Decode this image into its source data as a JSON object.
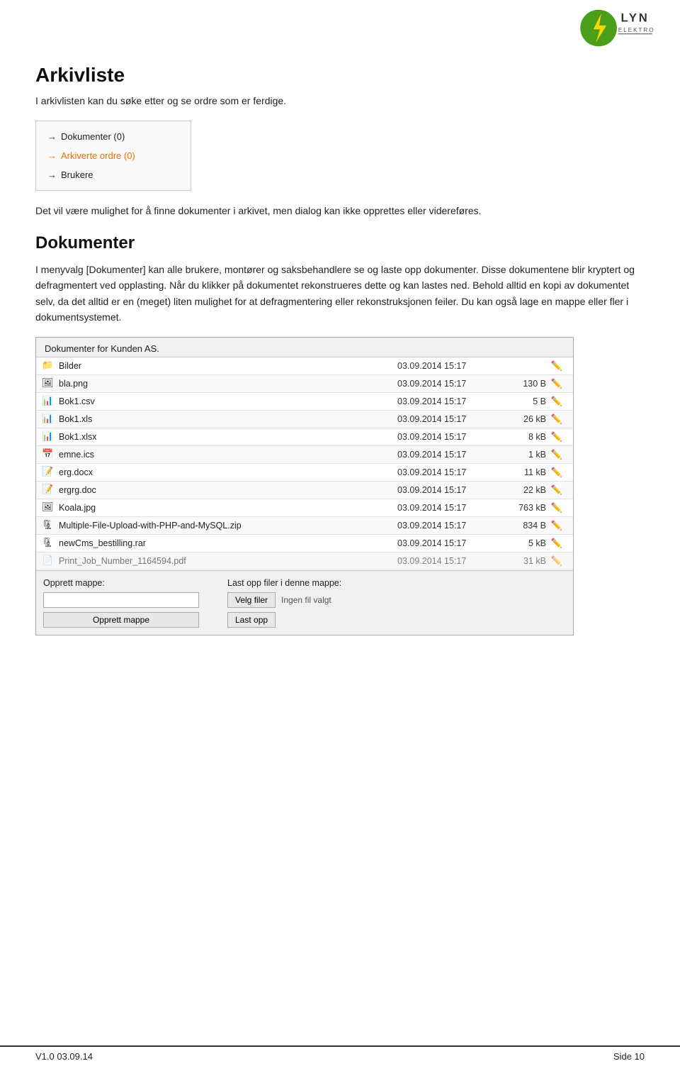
{
  "logo": {
    "alt": "Lyn Elektro logo"
  },
  "page": {
    "title": "Arkivliste",
    "intro": "I arkivlisten kan du søke etter og se ordre som er ferdige.",
    "menu_items": [
      {
        "label": "Dokumenter (0)",
        "style": "normal"
      },
      {
        "label": "Arkiverte ordre (0)",
        "style": "orange"
      },
      {
        "label": "Brukere",
        "style": "normal"
      }
    ],
    "caption": "Det vil være mulighet for å finne dokumenter i arkivet, men dialog kan ikke opprettes eller videreføres.",
    "section_title": "Dokumenter",
    "body1": "I menyvalg [Dokumenter] kan alle brukere, montører og saksbehandlere se og laste opp dokumenter. Disse dokumentene blir kryptert og defragmentert ved opplasting. Når du klikker på dokumentet rekonstrueres dette og kan lastes ned. Behold alltid en kopi av dokumentet selv, da det alltid er en (meget) liten mulighet for at defragmentering eller rekonstruksjonen feiler. Du kan også lage en mappe eller fler i dokumentsystemet.",
    "docs_panel": {
      "title": "Dokumenter for Kunden AS.",
      "rows": [
        {
          "icon": "📁",
          "name": "Bilder",
          "date": "03.09.2014 15:17",
          "size": "",
          "folder": true
        },
        {
          "icon": "🖼",
          "name": "bla.png",
          "date": "03.09.2014 15:17",
          "size": "130 B"
        },
        {
          "icon": "📊",
          "name": "Bok1.csv",
          "date": "03.09.2014 15:17",
          "size": "5 B"
        },
        {
          "icon": "📊",
          "name": "Bok1.xls",
          "date": "03.09.2014 15:17",
          "size": "26 kB"
        },
        {
          "icon": "📊",
          "name": "Bok1.xlsx",
          "date": "03.09.2014 15:17",
          "size": "8 kB"
        },
        {
          "icon": "📅",
          "name": "emne.ics",
          "date": "03.09.2014 15:17",
          "size": "1 kB"
        },
        {
          "icon": "📝",
          "name": "erg.docx",
          "date": "03.09.2014 15:17",
          "size": "11 kB"
        },
        {
          "icon": "📝",
          "name": "ergrg.doc",
          "date": "03.09.2014 15:17",
          "size": "22 kB"
        },
        {
          "icon": "🖼",
          "name": "Koala.jpg",
          "date": "03.09.2014 15:17",
          "size": "763 kB"
        },
        {
          "icon": "🗜",
          "name": "Multiple-File-Upload-with-PHP-and-MySQL.zip",
          "date": "03.09.2014 15:17",
          "size": "834 B"
        },
        {
          "icon": "🗜",
          "name": "newCms_bestilling.rar",
          "date": "03.09.2014 15:17",
          "size": "5 kB"
        },
        {
          "icon": "📄",
          "name": "Print_Job_Number_1164594.pdf",
          "date": "03.09.2014 15:17",
          "size": "31 kB"
        }
      ]
    },
    "create_folder_label": "Opprett mappe:",
    "create_folder_btn": "Opprett mappe",
    "upload_label": "Last opp filer i denne mappe:",
    "choose_files_btn": "Velg filer",
    "no_file_text": "Ingen fil valgt",
    "upload_btn": "Last opp"
  },
  "footer": {
    "version": "V1.0  03.09.14",
    "page": "Side 10"
  }
}
